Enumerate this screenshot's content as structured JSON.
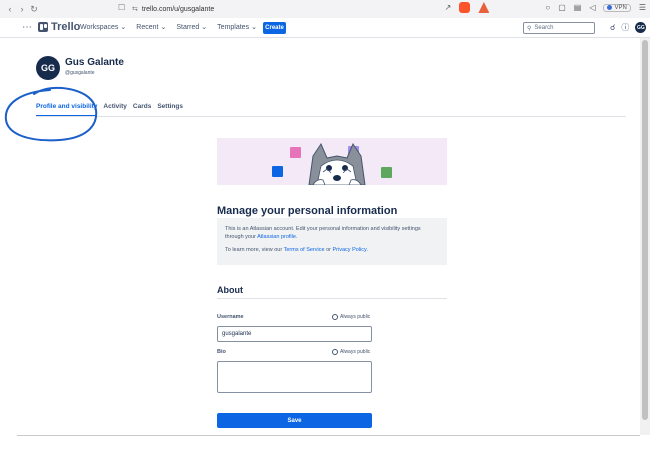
{
  "browser": {
    "url": "trello.com/u/gusgalante"
  },
  "header": {
    "logo": "Trello",
    "menu": [
      "Workspaces",
      "Recent",
      "Starred",
      "Templates"
    ],
    "create_label": "Create",
    "search_placeholder": "Search",
    "avatar_initials": "GG"
  },
  "profile": {
    "initials": "GG",
    "name": "Gus Galante",
    "handle": "@gusgalante"
  },
  "tabs": [
    "Profile and visibility",
    "Activity",
    "Cards",
    "Settings"
  ],
  "content": {
    "title": "Manage your personal information",
    "info_line1_pre": "This is an Atlassian account. Edit your personal information and visibility settings through your ",
    "info_line1_link": "Atlassian profile",
    "info_line1_post": ".",
    "info_line2_pre": "To learn more, view our ",
    "info_tos": "Terms of Service",
    "info_or": " or ",
    "info_privacy": "Privacy Policy",
    "info_line2_post": ".",
    "about_title": "About",
    "username_label": "Username",
    "username_value": "gusgalante",
    "bio_label": "Bio",
    "visibility": "Always public",
    "save_label": "Save"
  },
  "colors": {
    "accent": "#0c66e4",
    "text": "#172b4d",
    "annotation": "#1b5fc9"
  }
}
